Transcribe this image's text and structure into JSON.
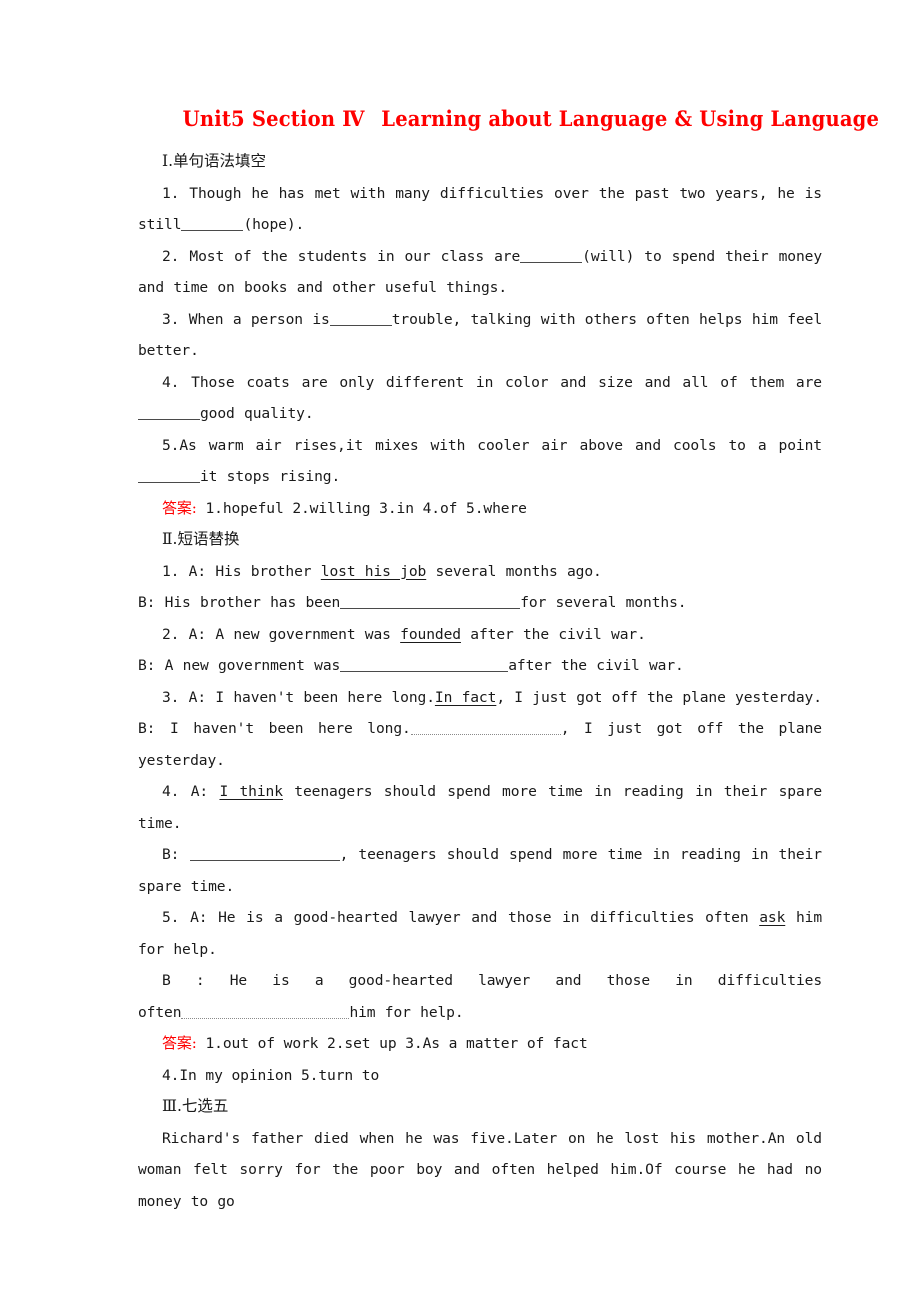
{
  "document": {
    "title_part1": "Unit5 Section Ⅳ",
    "title_part2": "Learning about Language & Using Language",
    "title_color": "#ff0000",
    "answer_label_color": "#ff0000"
  },
  "section1": {
    "heading": "Ⅰ.单句语法填空",
    "questions": [
      {
        "number": "1.",
        "text_before": "Though he has met with many difficulties over the past two years, he is still",
        "text_after": "(hope)."
      },
      {
        "number": "2.",
        "text_before": "Most of the students in our class are",
        "text_after": "(will) to spend their money and time on books and other useful things."
      },
      {
        "number": "3.",
        "text_before": "When a person is",
        "text_after": "trouble, talking with others often helps him feel better."
      },
      {
        "number": "4.",
        "text_before": "Those coats are only different in color and size and all of them are",
        "text_after": "good quality."
      },
      {
        "number": "5.",
        "text_before": "As warm air rises,it mixes with cooler air above and cools to a point",
        "text_after": "it stops rising."
      }
    ],
    "answer_label": "答案:",
    "answer_text": "1.hopeful  2.willing  3.in  4.of  5.where"
  },
  "section2": {
    "heading": "Ⅱ.短语替换",
    "items": [
      {
        "number": "1.",
        "a_label": "A:",
        "a_before": "His brother ",
        "a_underlined": "lost his job",
        "a_after": " several months ago.",
        "b_label": "B:",
        "b_before": "His brother has been",
        "b_after": "for several months."
      },
      {
        "number": "2.",
        "a_label": "A:",
        "a_before": "A new government was ",
        "a_underlined": "founded",
        "a_after": " after the civil war.",
        "b_label": "B:",
        "b_before": "A new government was",
        "b_after": "after the civil war."
      },
      {
        "number": "3.",
        "a_label": "A:",
        "a_before": "I haven't been here long.",
        "a_underlined": "In fact",
        "a_after": ", I just got off the plane yesterday.",
        "b_label": "B:",
        "b_before": "I haven't been here long.",
        "b_after": ", I just got off the plane yesterday."
      },
      {
        "number": "4.",
        "a_label": "A:",
        "a_before": "",
        "a_underlined": "I think",
        "a_after": " teenagers should spend more time in reading in their spare time.",
        "b_label": "B:",
        "b_before": "",
        "b_after": ", teenagers should spend more time in reading in their spare time."
      },
      {
        "number": "5.",
        "a_label": "A:",
        "a_before": "He is a good-hearted lawyer and those in difficulties often ",
        "a_underlined": "ask",
        "a_after": " him for help.",
        "b_label": "B :",
        "b_before": "He is a good-hearted lawyer and those in difficulties",
        "b_continuation_before": "often",
        "b_after": "him for help."
      }
    ],
    "answer_label": "答案:",
    "answer_text_line1": "1.out of work  2.set up  3.As a matter of fact",
    "answer_text_line2": "4.In my opinion  5.turn to"
  },
  "section3": {
    "heading": "Ⅲ.七选五",
    "paragraph": "Richard's father died when he was five.Later on he lost his mother.An old woman felt sorry for the poor boy and often helped him.Of course he had no money to go"
  }
}
